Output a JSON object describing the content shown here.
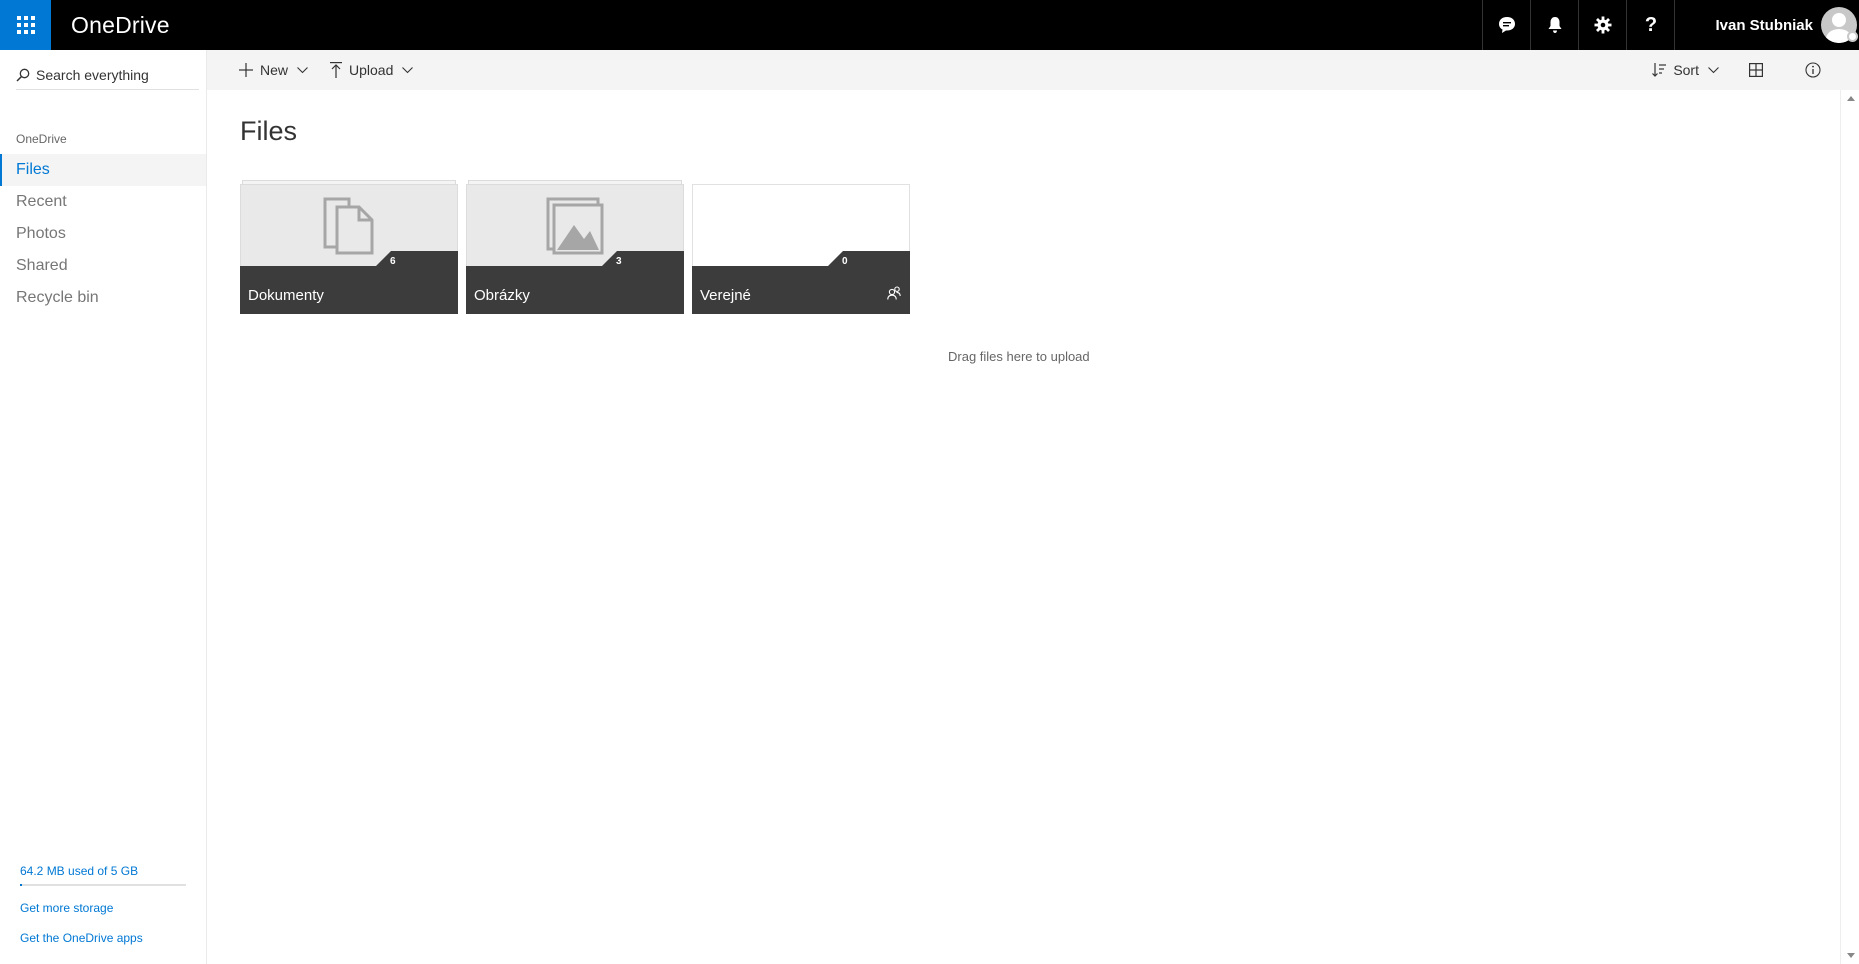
{
  "app": {
    "title": "OneDrive",
    "accent": "#0078d4"
  },
  "topbar": {
    "icons": [
      "feedback-icon",
      "bell-icon",
      "gear-icon",
      "help-icon"
    ],
    "help_glyph": "?",
    "user_name": "Ivan Stubniak"
  },
  "sidebar": {
    "search_placeholder": "Search everything",
    "heading": "OneDrive",
    "items": [
      {
        "label": "Files",
        "active": true
      },
      {
        "label": "Recent",
        "active": false
      },
      {
        "label": "Photos",
        "active": false
      },
      {
        "label": "Shared",
        "active": false
      },
      {
        "label": "Recycle bin",
        "active": false
      }
    ],
    "storage_text": "64.2 MB used of 5 GB",
    "storage_fraction": 0.0125,
    "links": [
      "Get more storage",
      "Get the OneDrive apps"
    ]
  },
  "commandbar": {
    "new_label": "New",
    "upload_label": "Upload",
    "sort_label": "Sort"
  },
  "main": {
    "title": "Files",
    "folders": [
      {
        "name": "Dokumenty",
        "count": "6",
        "icon": "documents-icon"
      },
      {
        "name": "Obrázky",
        "count": "3",
        "icon": "pictures-icon"
      },
      {
        "name": "Verejné",
        "count": "0",
        "icon": "shared-people-icon"
      }
    ],
    "drag_hint": "Drag files here to upload"
  }
}
